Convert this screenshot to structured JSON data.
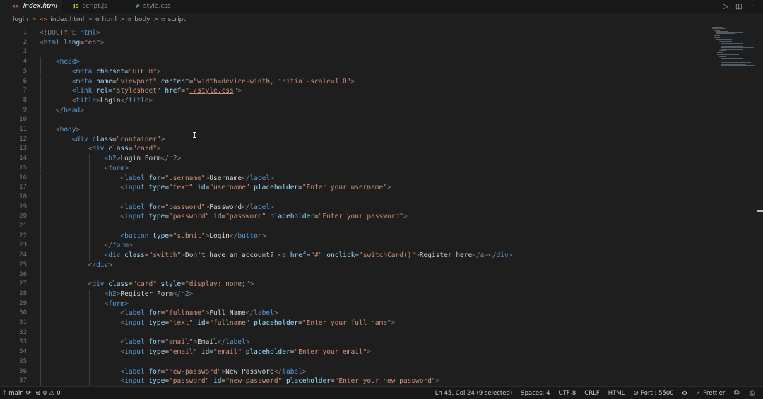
{
  "tabs": [
    {
      "icon": "<>",
      "label": "index.html",
      "active": true,
      "close": "✕"
    },
    {
      "icon": "JS",
      "label": "script.js",
      "active": false
    },
    {
      "icon": "#",
      "label": "style.css",
      "active": false
    }
  ],
  "tab_actions": {
    "run": "▷",
    "split": "◫",
    "more": "···"
  },
  "breadcrumb": {
    "folder": "login",
    "file_icon": "<>",
    "file": "index.html",
    "el1": "html",
    "el2": "body",
    "el3": "script",
    "sep": ">"
  },
  "editor": {
    "lines": [
      {
        "n": "1"
      },
      {
        "n": "2"
      },
      {
        "n": "3"
      },
      {
        "n": "4"
      },
      {
        "n": "5"
      },
      {
        "n": "6"
      },
      {
        "n": "7"
      },
      {
        "n": "8"
      },
      {
        "n": "9"
      },
      {
        "n": "10"
      },
      {
        "n": "11"
      },
      {
        "n": "12"
      },
      {
        "n": "13"
      },
      {
        "n": "14"
      },
      {
        "n": "15"
      },
      {
        "n": "16"
      },
      {
        "n": "17"
      },
      {
        "n": "18"
      },
      {
        "n": "19"
      },
      {
        "n": "20"
      },
      {
        "n": "21"
      },
      {
        "n": "22"
      },
      {
        "n": "23"
      },
      {
        "n": "24"
      },
      {
        "n": "25"
      },
      {
        "n": "26"
      },
      {
        "n": "27"
      },
      {
        "n": "28"
      },
      {
        "n": "29"
      },
      {
        "n": "30"
      },
      {
        "n": "31"
      },
      {
        "n": "32"
      },
      {
        "n": "33"
      },
      {
        "n": "34"
      },
      {
        "n": "35"
      },
      {
        "n": "36"
      },
      {
        "n": "37"
      }
    ],
    "code": {
      "l1": [
        "<!DOCTYPE ",
        "html",
        ">"
      ],
      "l2": [
        "<",
        "html",
        " lang",
        "=",
        "\"en\"",
        ">"
      ],
      "l4": [
        "<",
        "head",
        ">"
      ],
      "l5": [
        "<",
        "meta",
        " charset",
        "=",
        "\"UTF 8\"",
        ">"
      ],
      "l6": [
        "<",
        "meta",
        " name",
        "=",
        "\"viewport\"",
        " content",
        "=",
        "\"width=device-width, initial-scale=1.0\"",
        ">"
      ],
      "l7": [
        "<",
        "link",
        " rel",
        "=",
        "\"stylesheet\"",
        " href",
        "=",
        "\"",
        "./style.css",
        "\"",
        ">"
      ],
      "l8": [
        "<",
        "title",
        ">",
        "Login",
        "</",
        "title",
        ">"
      ],
      "l9": [
        "</",
        "head",
        ">"
      ],
      "l11": [
        "<",
        "body",
        ">"
      ],
      "l12": [
        "<",
        "div",
        " class",
        "=",
        "\"container\"",
        ">"
      ],
      "l13": [
        "<",
        "div",
        " class",
        "=",
        "\"card\"",
        ">"
      ],
      "l14": [
        "<",
        "h2",
        ">",
        "Login Form",
        "</",
        "h2",
        ">"
      ],
      "l15": [
        "<",
        "form",
        ">"
      ],
      "l16": [
        "<",
        "label",
        " for",
        "=",
        "\"username\"",
        ">",
        "Username",
        "</",
        "label",
        ">"
      ],
      "l17": [
        "<",
        "input",
        " type",
        "=",
        "\"text\"",
        " id",
        "=",
        "\"username\"",
        " placeholder",
        "=",
        "\"Enter your username\"",
        ">"
      ],
      "l19": [
        "<",
        "label",
        " for",
        "=",
        "\"password\"",
        ">",
        "Password",
        "</",
        "label",
        ">"
      ],
      "l20": [
        "<",
        "input",
        " type",
        "=",
        "\"password\"",
        " id",
        "=",
        "\"password\"",
        " placeholder",
        "=",
        "\"Enter your password\"",
        ">"
      ],
      "l22": [
        "<",
        "button",
        " type",
        "=",
        "\"submit\"",
        ">",
        "Login",
        "</",
        "button",
        ">"
      ],
      "l23": [
        "</",
        "form",
        ">"
      ],
      "l24": [
        "<",
        "div",
        " class",
        "=",
        "\"switch\"",
        ">",
        "Don't have an account? ",
        "<",
        "a",
        " href",
        "=",
        "\"#\"",
        " onclick",
        "=",
        "\"switchCard()\"",
        ">",
        "Register here",
        "</",
        "a",
        "></",
        "div",
        ">"
      ],
      "l25": [
        "</",
        "div",
        ">"
      ],
      "l27": [
        "<",
        "div",
        " class",
        "=",
        "\"card\"",
        " style",
        "=",
        "\"display: none;\"",
        ">"
      ],
      "l28": [
        "<",
        "h2",
        ">",
        "Register Form",
        "</",
        "h2",
        ">"
      ],
      "l29": [
        "<",
        "form",
        ">"
      ],
      "l30": [
        "<",
        "label",
        " for",
        "=",
        "\"fullname\"",
        ">",
        "Full Name",
        "</",
        "label",
        ">"
      ],
      "l31": [
        "<",
        "input",
        " type",
        "=",
        "\"text\"",
        " id",
        "=",
        "\"fullname\"",
        " placeholder",
        "=",
        "\"Enter your full name\"",
        ">"
      ],
      "l33": [
        "<",
        "label",
        " for",
        "=",
        "\"email\"",
        ">",
        "Email",
        "</",
        "label",
        ">"
      ],
      "l34": [
        "<",
        "input",
        " type",
        "=",
        "\"email\"",
        " id",
        "=",
        "\"email\"",
        " placeholder",
        "=",
        "\"Enter your email\"",
        ">"
      ],
      "l36": [
        "<",
        "label",
        " for",
        "=",
        "\"new-password\"",
        ">",
        "New Password",
        "</",
        "label",
        ">"
      ],
      "l37": [
        "<",
        "input",
        " type",
        "=",
        "\"password\"",
        " id",
        "=",
        "\"new-password\"",
        " placeholder",
        "=",
        "\"Enter your new password\"",
        ">"
      ]
    }
  },
  "status": {
    "branch": "main",
    "sync_icon": "⟳",
    "errors": "0",
    "warnings": "0",
    "position": "Ln 45, Col 24 (9 selected)",
    "spaces": "Spaces: 4",
    "encoding": "UTF-8",
    "eol": "CRLF",
    "language": "HTML",
    "port": "Port : 5500",
    "prettier": "Prettier",
    "colors": {
      "background": "#181818",
      "editor": "#1e1e1e",
      "tag": "#569cd6",
      "attr": "#9cdcfe",
      "string": "#ce9178"
    }
  }
}
